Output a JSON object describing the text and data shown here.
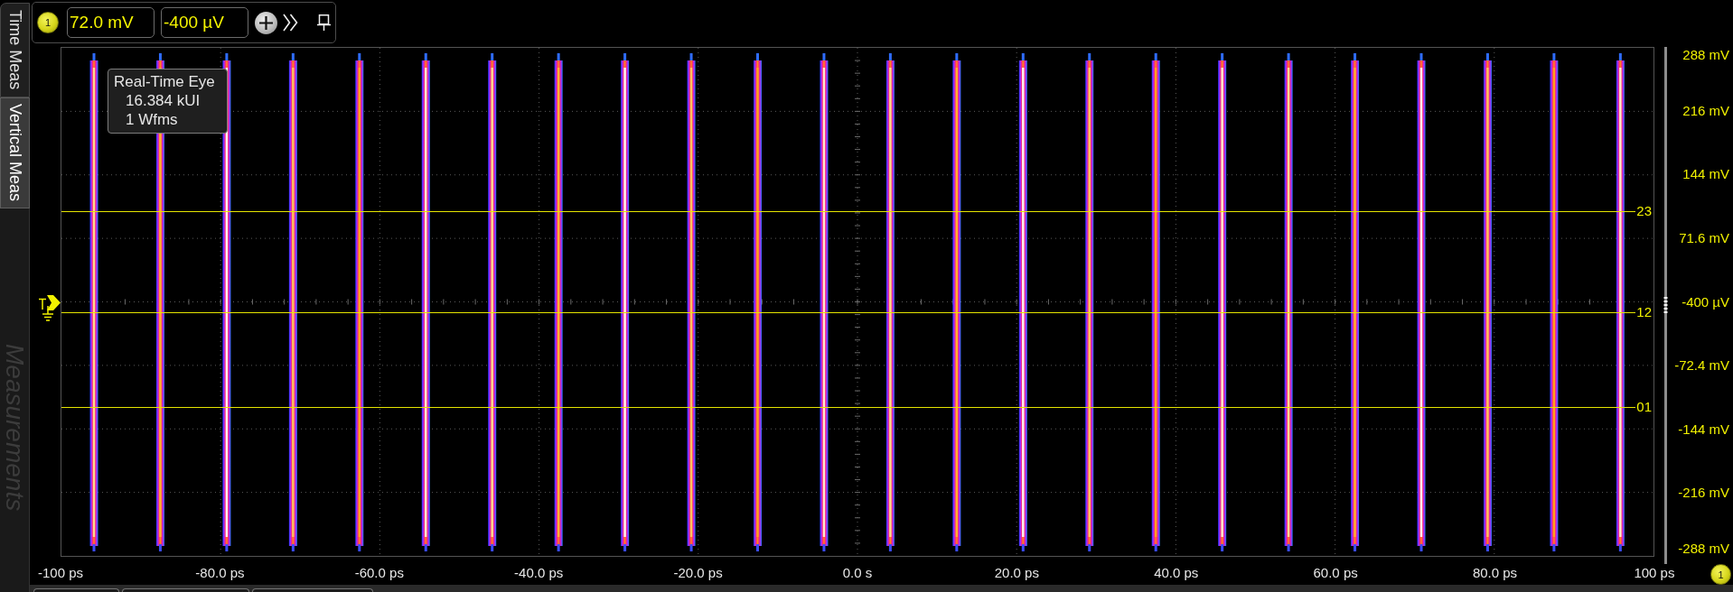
{
  "sidebar": {
    "tabs": [
      {
        "label": "Time Meas",
        "selected": false
      },
      {
        "label": "Vertical Meas",
        "selected": true
      }
    ],
    "panel_title": "Measurements"
  },
  "toolbar": {
    "channel": "1",
    "fields": [
      {
        "value": "72.0 mV"
      },
      {
        "value": "-400 µV"
      }
    ]
  },
  "readout": {
    "title": "Real-Time Eye",
    "lines": [
      "16.384 kUI",
      "1 Wfms"
    ]
  },
  "reference_levels": [
    {
      "label": "23"
    },
    {
      "label": "12"
    },
    {
      "label": "01"
    }
  ],
  "y_axis": {
    "labels": [
      "288 mV",
      "216 mV",
      "144 mV",
      "71.6 mV",
      "-400 µV",
      "-72.4 mV",
      "-144 mV",
      "-216 mV",
      "-288 mV"
    ]
  },
  "x_axis": {
    "labels": [
      "-100 ps",
      "-80.0 ps",
      "-60.0 ps",
      "-40.0 ps",
      "-20.0 ps",
      "0.0 s",
      "20.0 ps",
      "40.0 ps",
      "60.0 ps",
      "80.0 ps",
      "100 ps"
    ]
  },
  "channel_badge": "1"
}
